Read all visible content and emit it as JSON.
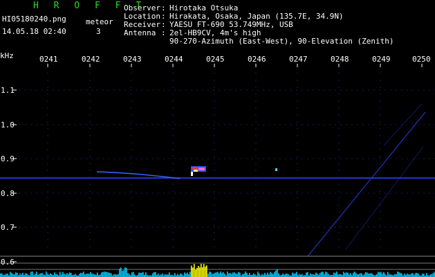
{
  "brand": "H R O F F T",
  "filename": "HI05180240.png",
  "timestamp": "14.05.18 02:40",
  "meteor": {
    "label": "meteor",
    "count": "3"
  },
  "header": [
    {
      "key": "Observer",
      "sep": ":",
      "value": "Hirotaka Otsuka"
    },
    {
      "key": "Location",
      "sep": ":",
      "value": "Hirakata, Osaka, Japan (135.7E, 34.9N)"
    },
    {
      "key": "Receiver",
      "sep": ":",
      "value": "YAESU FT-690 53.749MHz, USB"
    },
    {
      "key": "Antenna",
      "sep": ":",
      "value": "2el-HB9CV, 4m's high"
    },
    {
      "key": "",
      "sep": "",
      "value": "90-270-Azimuth (East-West), 90-Elevation (Zenith)"
    }
  ],
  "axis": {
    "unit": "kHz",
    "time_ticks": [
      "0241",
      "0242",
      "0243",
      "0244",
      "0245",
      "0246",
      "0247",
      "0248",
      "0249",
      "0250"
    ],
    "freq_ticks": [
      "1.1",
      "1.0",
      "0.9",
      "0.8",
      "0.7",
      "0.6"
    ]
  },
  "colors": {
    "brand": "#22dd22",
    "text": "#ffffff",
    "carrier": "#2233cc",
    "signal_hot": "#ff3333",
    "spectrum": "#00ccff",
    "spectrum_peak": "#ffff00"
  }
}
